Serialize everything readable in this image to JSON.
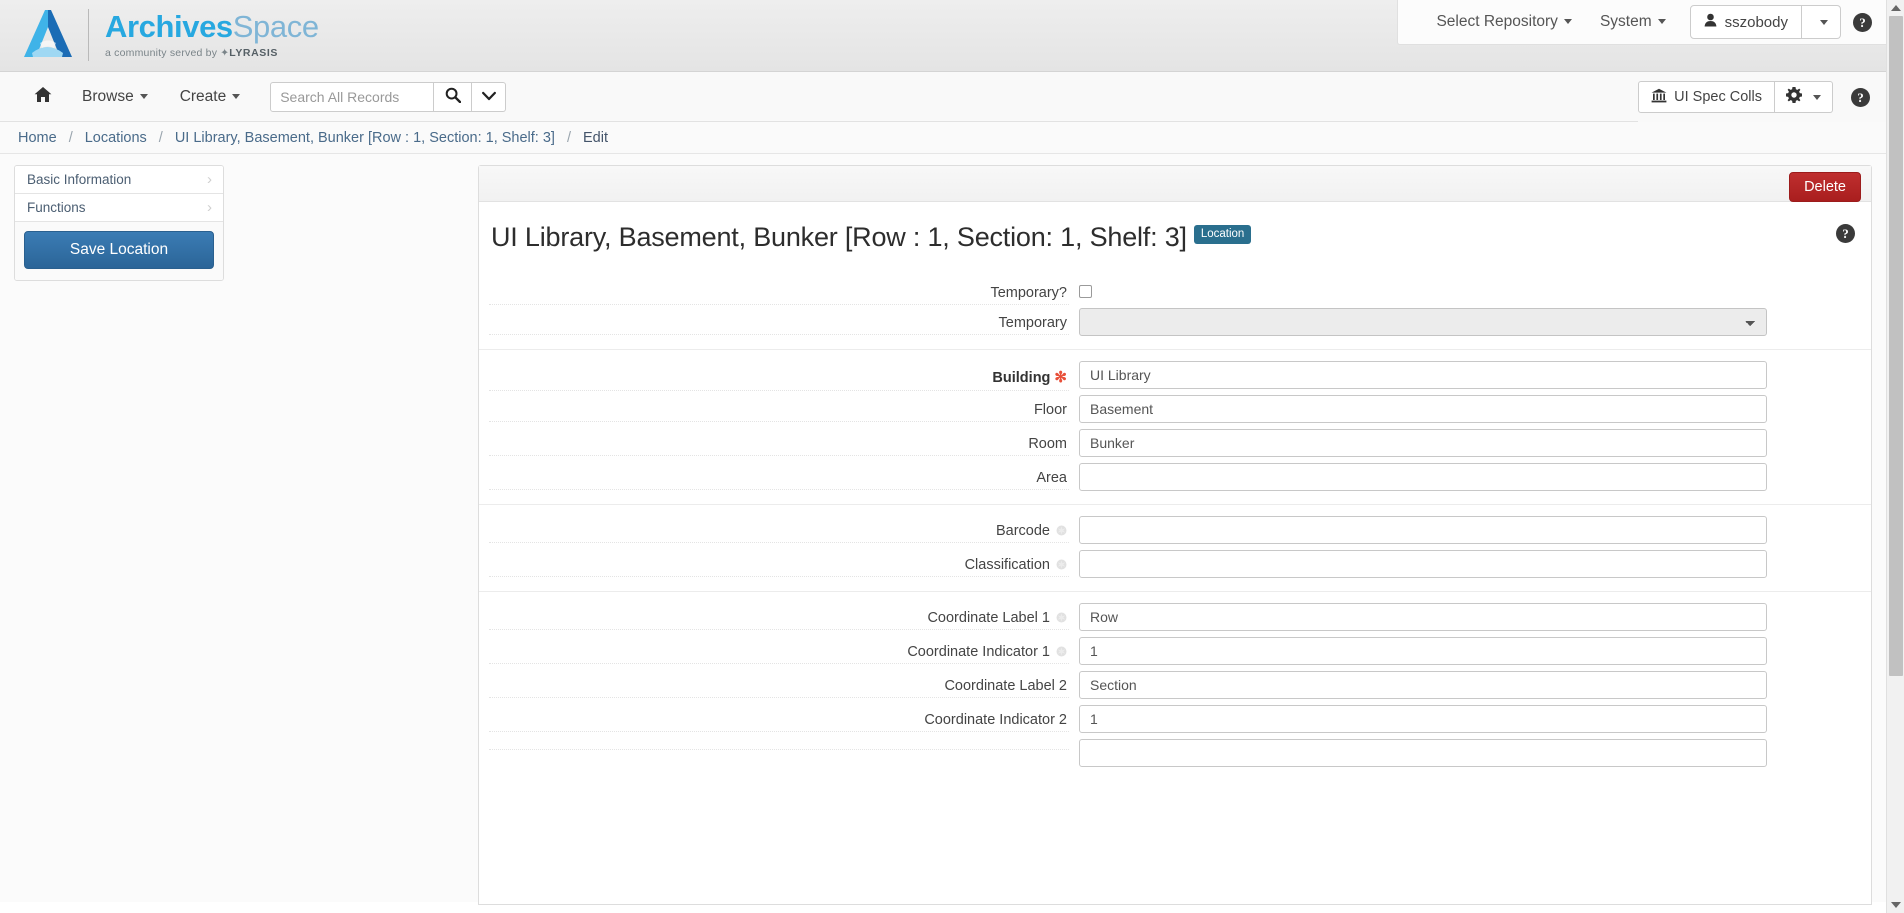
{
  "brand": {
    "name_part1": "Archives",
    "name_part2": "Space",
    "tagline_prefix": "a community served by ",
    "tagline_org": "LYRASIS",
    "logo_icon": "archivesspace-a-logo"
  },
  "topbar": {
    "select_repository": "Select Repository",
    "system": "System",
    "username": "sszobody",
    "user_icon": "user-icon",
    "user_caret_icon": "caret-down-icon",
    "help_icon": "help-circle-icon"
  },
  "navbar": {
    "home_icon": "home-icon",
    "browse": "Browse",
    "create": "Create",
    "search_placeholder": "Search All Records",
    "search_value": "",
    "search_icon": "search-icon",
    "search_caret_icon": "chevron-down-icon",
    "repository": "UI Spec Colls",
    "repository_icon": "bank-icon",
    "gear_icon": "gear-icon",
    "gear_caret_icon": "caret-down-icon",
    "help_icon": "help-circle-icon"
  },
  "breadcrumb": {
    "separator": "/",
    "items": [
      {
        "label": "Home",
        "link": true
      },
      {
        "label": "Locations",
        "link": true
      },
      {
        "label": "UI Library, Basement, Bunker [Row : 1, Section: 1, Shelf: 3]",
        "link": true
      },
      {
        "label": "Edit",
        "link": false
      }
    ]
  },
  "sidebar": {
    "items": [
      {
        "label": "Basic Information",
        "chevron": "chevron-right-icon"
      },
      {
        "label": "Functions",
        "chevron": "chevron-right-icon"
      }
    ],
    "save_label": "Save Location"
  },
  "record": {
    "delete_label": "Delete",
    "title": "UI Library, Basement, Bunker [Row : 1, Section: 1, Shelf: 3]",
    "badge": "Location",
    "help_icon": "help-circle-icon"
  },
  "form": {
    "sections": [
      {
        "rows": [
          {
            "label": "Temporary?",
            "type": "checkbox",
            "checked": false,
            "required": false,
            "help": false
          },
          {
            "label": "Temporary",
            "type": "select",
            "value": "",
            "required": false,
            "help": false
          }
        ]
      },
      {
        "rows": [
          {
            "label": "Building",
            "type": "text",
            "value": "UI Library",
            "required": true,
            "help": false,
            "bold": true
          },
          {
            "label": "Floor",
            "type": "text",
            "value": "Basement",
            "required": false,
            "help": false
          },
          {
            "label": "Room",
            "type": "text",
            "value": "Bunker",
            "required": false,
            "help": false
          },
          {
            "label": "Area",
            "type": "text",
            "value": "",
            "required": false,
            "help": false
          }
        ]
      },
      {
        "rows": [
          {
            "label": "Barcode",
            "type": "text",
            "value": "",
            "required": false,
            "help": true
          },
          {
            "label": "Classification",
            "type": "text",
            "value": "",
            "required": false,
            "help": true
          }
        ]
      },
      {
        "rows": [
          {
            "label": "Coordinate Label 1",
            "type": "text",
            "value": "Row",
            "required": false,
            "help": true
          },
          {
            "label": "Coordinate Indicator 1",
            "type": "text",
            "value": "1",
            "required": false,
            "help": true
          },
          {
            "label": "Coordinate Label 2",
            "type": "text",
            "value": "Section",
            "required": false,
            "help": false
          },
          {
            "label": "Coordinate Indicator 2",
            "type": "text",
            "value": "1",
            "required": false,
            "help": false
          },
          {
            "label": "",
            "type": "text",
            "value": "",
            "required": false,
            "help": false
          }
        ]
      }
    ]
  },
  "scrollbar": {
    "up_icon": "triangle-up-icon",
    "down_icon": "triangle-down-icon"
  },
  "colors": {
    "brand_blue": "#27a8e0",
    "save_blue": "#2f6ea5",
    "delete_red": "#b22222",
    "badge_teal": "#2a6f8e",
    "required_star": "#e8503a"
  }
}
